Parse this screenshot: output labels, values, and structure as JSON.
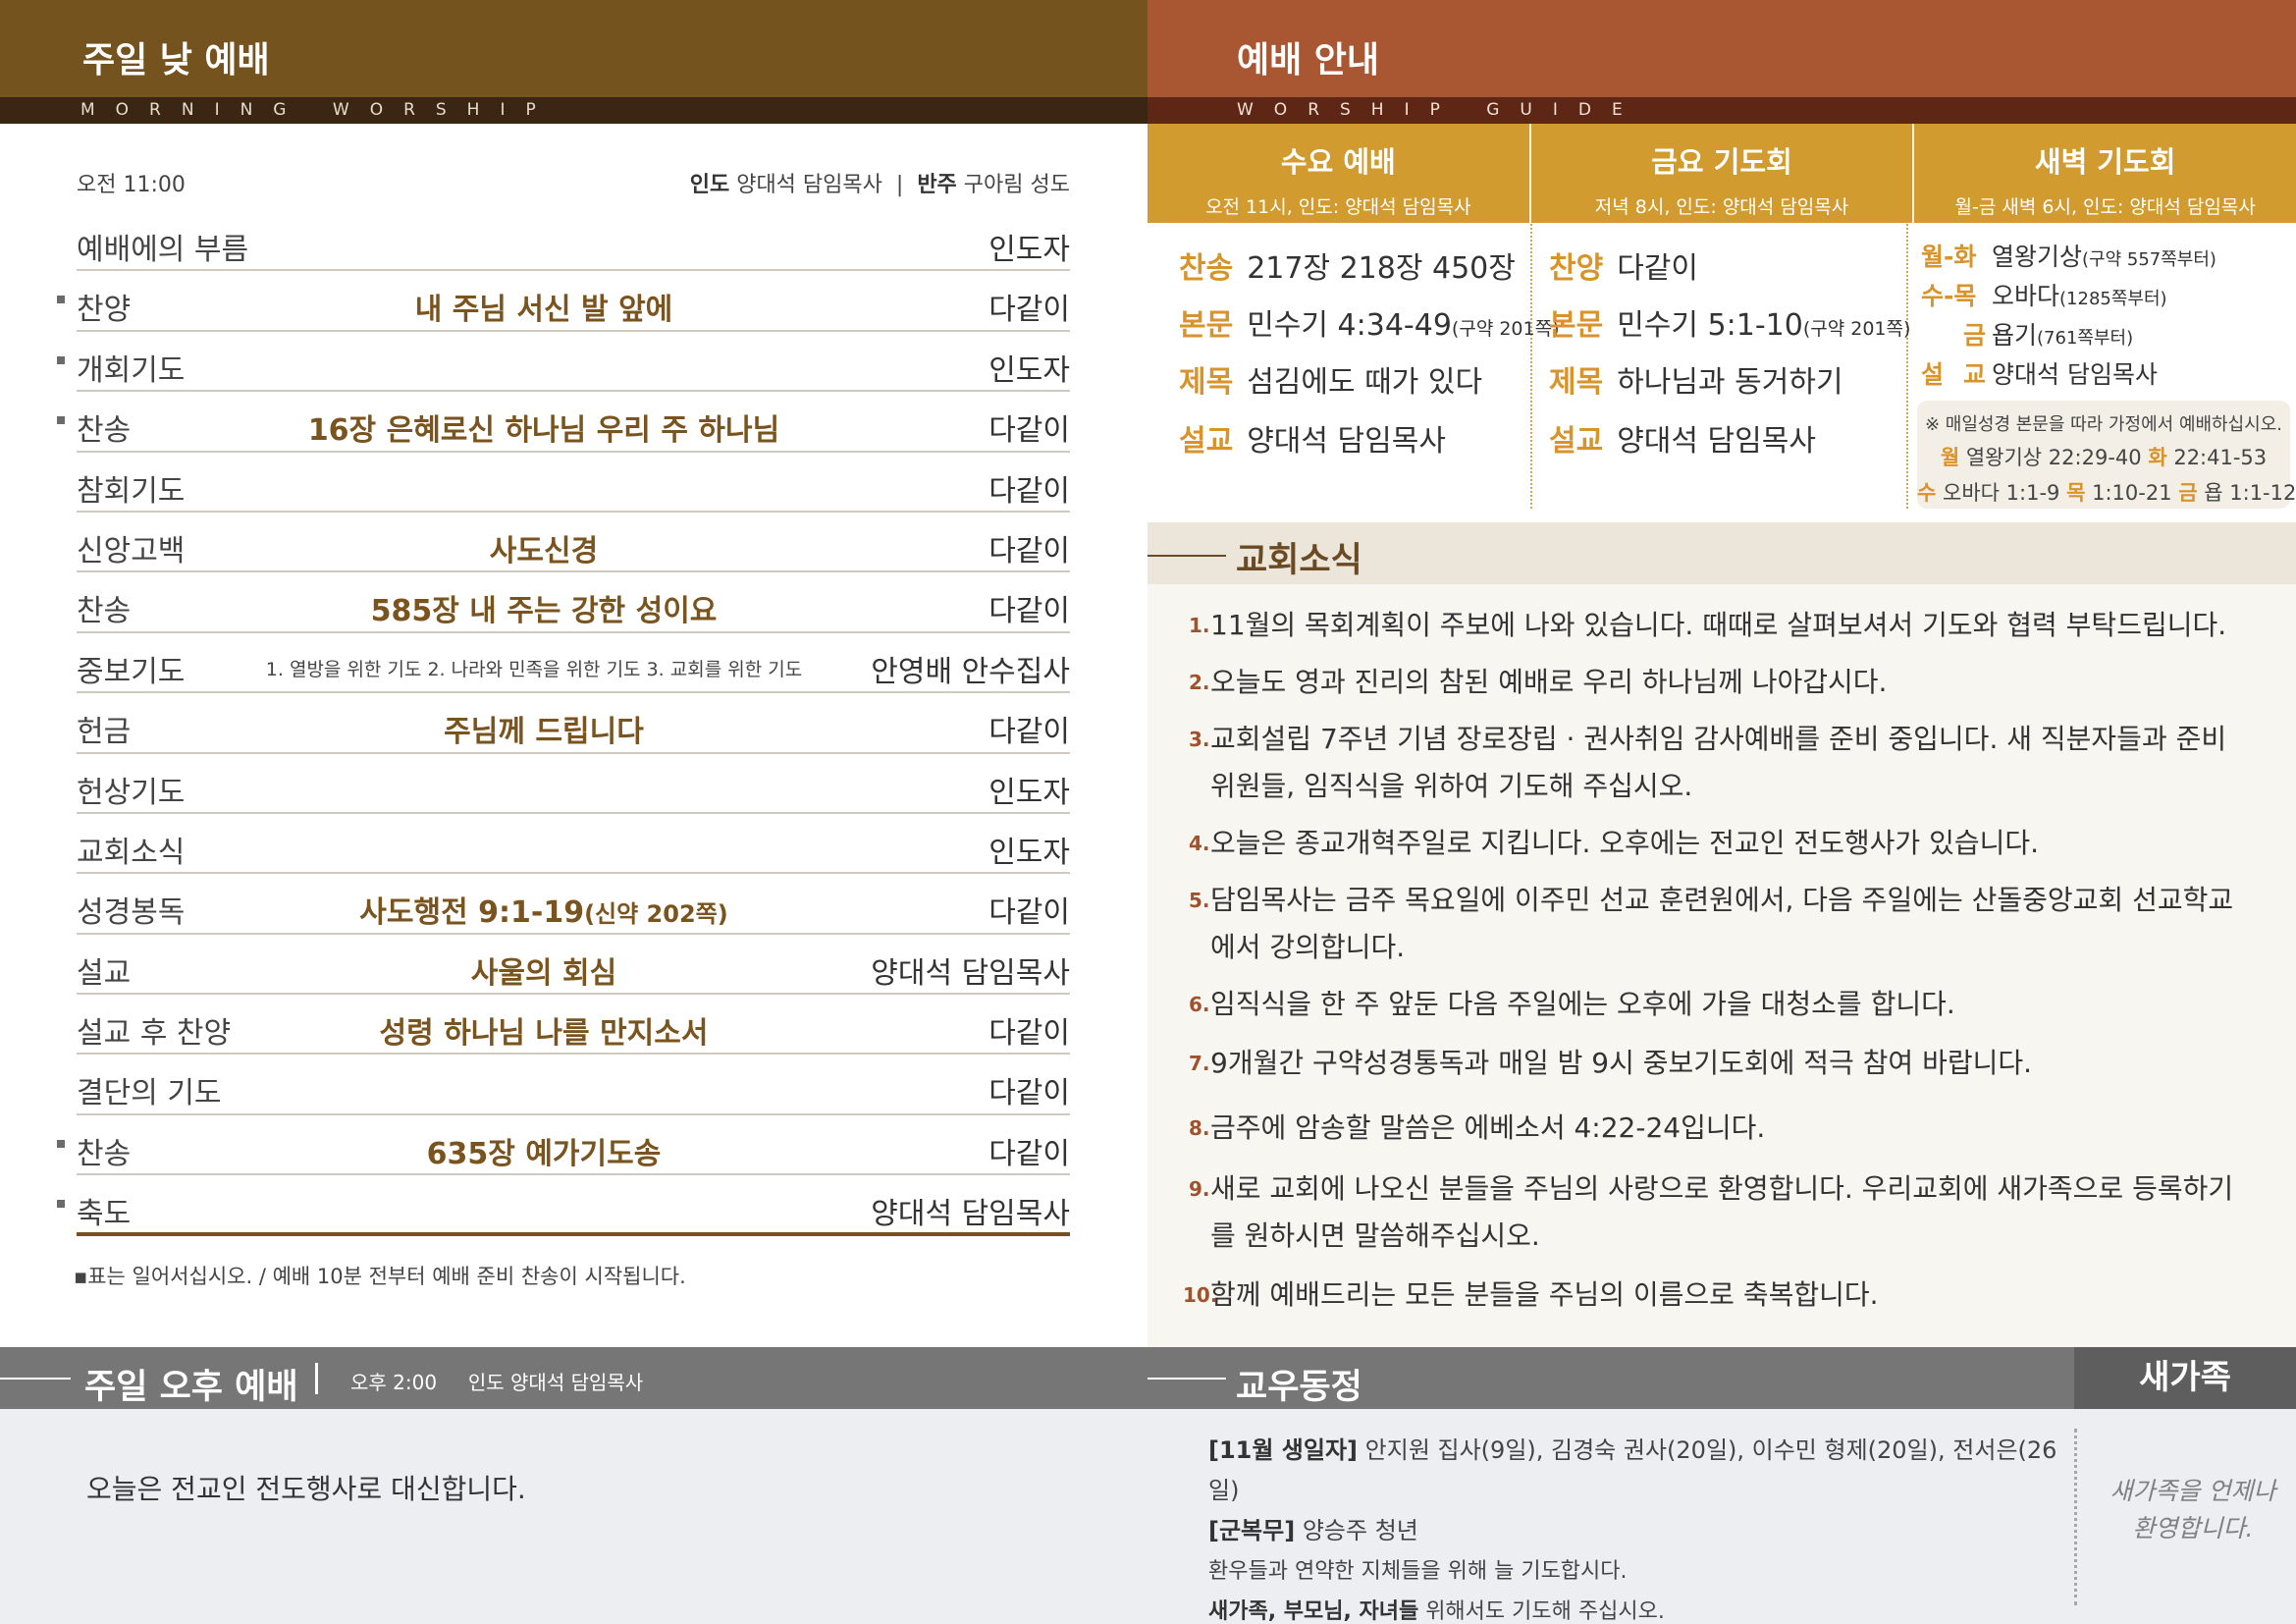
{
  "morning": {
    "title": "주일 낮 예배",
    "subtitle": "MORNING   WORSHIP",
    "time": "오전 11:00",
    "leader_label": "인도",
    "leader": "양대석 담임목사",
    "divider": "|",
    "accomp_label": "반주",
    "accomp": "구아림 성도",
    "order": [
      {
        "name": "예배에의 부름",
        "content": "",
        "who": "인도자"
      },
      {
        "name": "찬양",
        "content": "내 주님 서신 발 앞에",
        "who": "다같이"
      },
      {
        "name": "개회기도",
        "content": "",
        "who": "인도자"
      },
      {
        "name": "찬송",
        "content": "16장 은혜로신 하나님 우리 주 하나님",
        "who": "다같이"
      },
      {
        "name": "참회기도",
        "content": "",
        "who": "다같이"
      },
      {
        "name": "신앙고백",
        "content": "사도신경",
        "who": "다같이"
      },
      {
        "name": "찬송",
        "content": "585장 내 주는 강한 성이요",
        "who": "다같이"
      },
      {
        "name": "중보기도",
        "content": "1. 열방을 위한 기도  2. 나라와 민족을 위한 기도  3. 교회를 위한 기도",
        "who": "안영배 안수집사"
      },
      {
        "name": "헌금",
        "content": "주님께 드립니다",
        "who": "다같이"
      },
      {
        "name": "헌상기도",
        "content": "",
        "who": "인도자"
      },
      {
        "name": "교회소식",
        "content": "",
        "who": "인도자"
      },
      {
        "name": "성경봉독",
        "content": "사도행전 9:1-19",
        "content_sub": "(신약 202쪽)",
        "who": "다같이"
      },
      {
        "name": "설교",
        "content": "사울의 회심",
        "who": "양대석 담임목사"
      },
      {
        "name": "설교 후 찬양",
        "content": "성령 하나님 나를 만지소서",
        "who": "다같이"
      },
      {
        "name": "결단의 기도",
        "content": "",
        "who": "다같이"
      },
      {
        "name": "찬송",
        "content": "635장 예가기도송",
        "who": "다같이"
      },
      {
        "name": "축도",
        "content": "",
        "who": "양대석 담임목사"
      }
    ],
    "note": "▪표는 일어서십시오. / 예배 10분 전부터 예배 준비 찬송이 시작됩니다."
  },
  "afternoon": {
    "title": "주일 오후 예배",
    "time": "오후 2:00",
    "leader": "인도 양대석 담임목사",
    "text": "오늘은 전교인 전도행사로 대신합니다."
  },
  "guide": {
    "title": "예배 안내",
    "subtitle": "WORSHIP   GUIDE",
    "wed": {
      "title": "수요 예배",
      "sub": "오전 11시, 인도: 양대석 담임목사",
      "hymn_label": "찬송",
      "hymn": "217장 218장 450장",
      "text_label": "본문",
      "text": "민수기 4:34-49",
      "text_ref": "(구약 201쪽)",
      "topic_label": "제목",
      "topic": "섬김에도 때가 있다",
      "preacher_label": "설교",
      "preacher": "양대석 담임목사"
    },
    "fri": {
      "title": "금요 기도회",
      "sub": "저녁 8시, 인도: 양대석 담임목사",
      "hymn_label": "찬양",
      "hymn": "다같이",
      "text_label": "본문",
      "text": "민수기 5:1-10",
      "text_ref": "(구약 201쪽)",
      "topic_label": "제목",
      "topic": "하나님과 동거하기",
      "preacher_label": "설교",
      "preacher": "양대석 담임목사"
    },
    "dawn": {
      "title": "새벽 기도회",
      "sub": "월-금 새벽 6시, 인도: 양대석 담임목사",
      "l1_label": "월-화",
      "l1": "열왕기상",
      "l1_ref": "(구약 557쪽부터)",
      "l2_label": "수-목",
      "l2": "오바다",
      "l2_ref": "(1285쪽부터)",
      "l3_label": "금",
      "l3": "욥기",
      "l3_ref": "(761쪽부터)",
      "l4_label": "설 교",
      "l4": "양대석 담임목사",
      "daily_note": "※ 매일성경 본문을 따라 가정에서 예배하십시오.",
      "d1_label": "월",
      "d1": "열왕기상 22:29-40",
      "d2_label": "화",
      "d2": "22:41-53",
      "d3_label": "수",
      "d3": "오바다 1:1-9",
      "d4_label": "목",
      "d4": "1:10-21",
      "d5_label": "금",
      "d5": "욥 1:1-12"
    }
  },
  "news": {
    "title": "교회소식",
    "items": [
      {
        "num": "1.",
        "text": "11월의 목회계획이 주보에 나와 있습니다. 때때로 살펴보셔서 기도와 협력 부탁드립니다."
      },
      {
        "num": "2.",
        "text": "오늘도 영과 진리의 참된 예배로 우리 하나님께 나아갑시다."
      },
      {
        "num": "3.",
        "text": "교회설립 7주년 기념 장로장립 · 권사취임 감사예배를 준비 중입니다. 새 직분자들과 준비위원들, 임직식을 위하여 기도해 주십시오."
      },
      {
        "num": "4.",
        "text": "오늘은 종교개혁주일로 지킵니다. 오후에는 전교인 전도행사가 있습니다."
      },
      {
        "num": "5.",
        "text": "담임목사는 금주 목요일에 이주민 선교 훈련원에서, 다음 주일에는 산돌중앙교회 선교학교에서 강의합니다."
      },
      {
        "num": "6.",
        "text": "임직식을 한 주 앞둔 다음 주일에는 오후에 가을 대청소를 합니다."
      },
      {
        "num": "7.",
        "text": "9개월간 구약성경통독과 매일 밤 9시 중보기도회에 적극 참여 바랍니다."
      },
      {
        "num": "8.",
        "text": "금주에 암송할 말씀은 에베소서 4:22-24입니다."
      },
      {
        "num": "9.",
        "text": "새로 교회에 나오신 분들을 주님의 사랑으로 환영합니다. 우리교회에 새가족으로 등록하기를 원하시면 말씀해주십시오."
      },
      {
        "num": "10.",
        "text": "함께 예배드리는 모든 분들을 주님의 이름으로 축복합니다."
      }
    ]
  },
  "members": {
    "title": "교우동정",
    "birthday_label": "[11월 생일자]",
    "birthday": "안지원 집사(9일), 김경숙 권사(20일), 이수민 형제(20일), 전서은(26일)",
    "military_label": "[군복무]",
    "military": "양승주 청년",
    "pray1": "환우들과 연약한 지체들을 위해 늘 기도합시다.",
    "pray2_bold": "새가족, 부모님, 자녀들",
    "pray2": " 위해서도 기도해 주십시오."
  },
  "newfam": {
    "title": "새가족",
    "line1": "새가족을 언제나",
    "line2": "환영합니다."
  }
}
